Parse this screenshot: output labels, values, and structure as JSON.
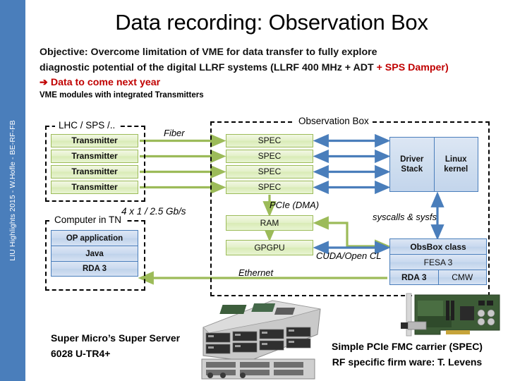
{
  "sidebar": {
    "label": "LIU Highlights 2015 -  W.Hofle - BE-RF-FB",
    "color": "#4a7ebb"
  },
  "slide": {
    "title": "Data recording: Observation Box",
    "objective_line1": "Objective: Overcome limitation of VME for data transfer to fully explore",
    "objective_line2_black": "diagnostic potential of the digital LLRF systems (LLRF 400  MHz + ADT ",
    "objective_line2_red": "+ SPS Damper)",
    "objective_line3": "➔ Data to come next year",
    "vme_caption": "VME modules with integrated Transmitters",
    "accent_red": "#c00000"
  },
  "diagram": {
    "lhc_box_title": "LHC / SPS /..",
    "transmitters": [
      "Transmitter",
      "Transmitter",
      "Transmitter",
      "Transmitter"
    ],
    "obs_box_title": "Observation Box",
    "specs": [
      "SPEC",
      "SPEC",
      "SPEC",
      "SPEC"
    ],
    "ram": "RAM",
    "gpgpu": "GPGPU",
    "driver_stack": "Driver Stack",
    "linux_kernel": "Linux kernel",
    "obs_stack": [
      [
        "ObsBox class"
      ],
      [
        "FESA 3"
      ],
      [
        "RDA 3",
        "CMW"
      ]
    ],
    "tn_box_title": "Computer in TN",
    "tn_stack": [
      "OP application",
      "Java",
      "RDA 3"
    ],
    "labels": {
      "fiber": "Fiber",
      "gbps": "4 x 1 / 2.5 Gb/s",
      "pcie": "PCIe (DMA)",
      "syscalls": "syscalls & sysfs",
      "cuda": "CUDA/Open CL",
      "ethernet": "Ethernet"
    },
    "colors": {
      "green_fill": "#e3f0c8",
      "green_border": "#9cbb59",
      "blue_fill": "#c6d9f0",
      "blue_border": "#4a7ebb",
      "green_arrow": "#9cbb59",
      "blue_arrow": "#4a7ebb"
    }
  },
  "photos": {
    "server_caption": "Super Micro’s Super Server 6028 U-TR4+",
    "spec_caption_line1": "Simple PCIe FMC carrier (SPEC)",
    "spec_caption_line2": "RF specific firm ware: T. Levens"
  }
}
